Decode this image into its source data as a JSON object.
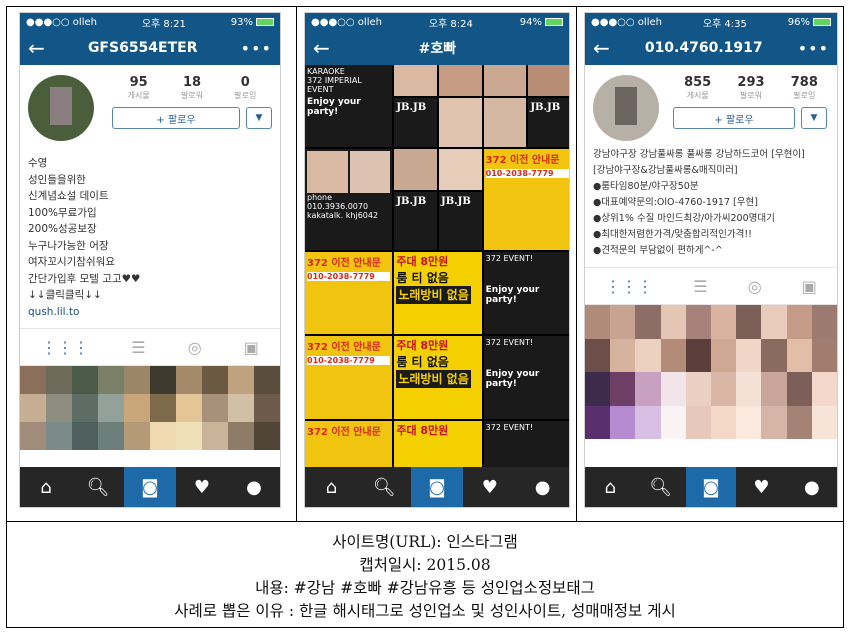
{
  "phone1": {
    "status": {
      "carrier": "●●●○○ olleh",
      "time": "오후 8:21",
      "battery": "93%"
    },
    "nav": {
      "title": "GFS6554ETER",
      "back": "←",
      "more": "•••"
    },
    "stats": [
      {
        "n": "95",
        "l": "게시물"
      },
      {
        "n": "18",
        "l": "팔로워"
      },
      {
        "n": "0",
        "l": "팔로잉"
      }
    ],
    "follow": "+ 팔로우",
    "bio": [
      "수영",
      "성인들을위한",
      "신계념쇼설 데이트",
      "100%무료가입",
      "200%성공보장",
      "누구나가능한 어장",
      "여자꼬시기참쉬워요",
      "간단가입후 모텔 고고♥♥",
      "↓↓클릭클릭↓↓"
    ],
    "link": "qush.lil.to"
  },
  "phone2": {
    "status": {
      "carrier": "●●●○○ olleh",
      "time": "오후 8:24",
      "battery": "94%"
    },
    "nav": {
      "title": "#호빠",
      "back": "←"
    },
    "posts": {
      "karaoke": "KARAOKE",
      "event": "372 IMPERIAL EVENT",
      "jbjb": "JB.JB",
      "party": "Enjoy your party!",
      "event2": "372 EVENT!",
      "enjoy": "Enjoy your party!",
      "phone": "phone 010.3936.0070",
      "kakao": "kakatalk. khj6042",
      "yellow_head": "372 이전 안내문",
      "yellow_phone": "010-2038-7779",
      "room_price": "주대 8만원",
      "room_line1": "룸 티 없음",
      "room_line2": "노래방비 없음"
    }
  },
  "phone3": {
    "status": {
      "carrier": "●●●○○ olleh",
      "time": "오후 4:35",
      "battery": "96%"
    },
    "nav": {
      "title": "010.4760.1917",
      "back": "←",
      "more": "•••"
    },
    "stats": [
      {
        "n": "855",
        "l": "게시물"
      },
      {
        "n": "293",
        "l": "팔로워"
      },
      {
        "n": "788",
        "l": "팔로잉"
      }
    ],
    "follow": "+ 팔로우",
    "bio": [
      "강남야구장 강남풀싸롱 풀싸롱 강남하드코어 [우현이]",
      "[강남야구장&강남풀싸롱&매직미러]",
      "●룸타임80분/야구장50분",
      "●대표예약문의:OlO-4760-1917 [우현]",
      "●상위1% 수질 마인드최강/아가씨200명대기",
      "●최대한저렴한가격/맞춤합리적인가격!!",
      "●견적문의 부담없이 편하게^-^"
    ]
  },
  "caption": [
    "사이트명(URL): 인스타그램",
    "캡처일시: 2015.08",
    "내용: #강남 #호빠 #강남유흥 등 성인업소정보태그",
    "사례로 뽑은 이유 : 한글 해시태그로 성인업소 및 성인사이트, 성매매정보 게시"
  ],
  "colors": {
    "nav": "#125688",
    "accent": "#3d79b6",
    "bottom_bar": "#262626",
    "bottom_selected": "#1e6aa8"
  },
  "icons": {
    "home": "home-icon",
    "search": "search-icon",
    "camera": "camera-icon",
    "activity": "activity-icon",
    "profile": "profile-icon"
  }
}
